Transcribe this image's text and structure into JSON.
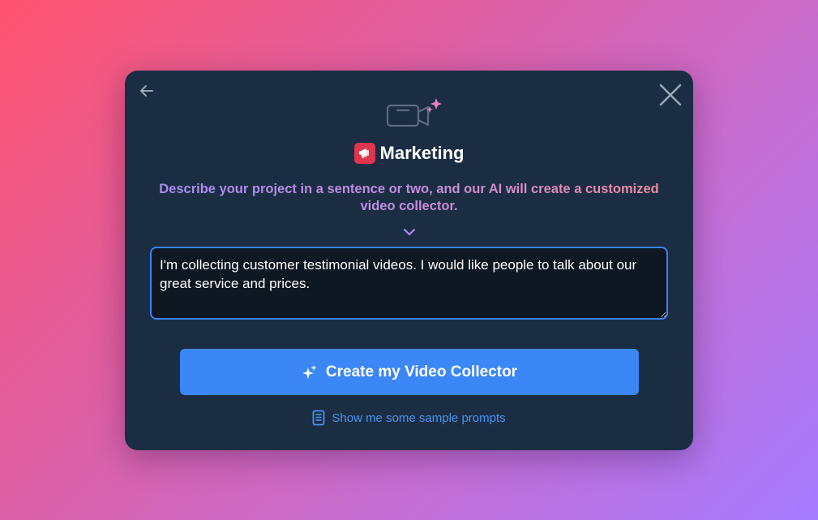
{
  "modal": {
    "title": "Marketing",
    "title_icon": "megaphone-icon",
    "description": "Describe your project in a sentence or two, and our AI will create a customized video collector.",
    "prompt": {
      "value": "I'm collecting customer testimonial videos. I would like people to talk about our great service and prices."
    },
    "create_button_label": "Create my Video Collector",
    "sample_prompts_label": "Show me some sample prompts"
  },
  "colors": {
    "background_start": "#ff5470",
    "background_end": "#a47bff",
    "modal_bg": "#1b2d42",
    "accent": "#3b87f5"
  },
  "icons": [
    "back-arrow-icon",
    "close-icon",
    "video-camera-sparkles-icon",
    "megaphone-icon",
    "chevron-down-icon",
    "sparkles-icon",
    "document-icon"
  ]
}
